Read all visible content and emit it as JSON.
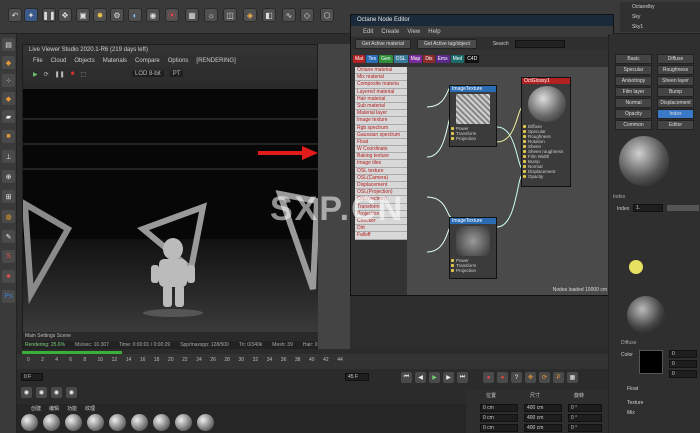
{
  "top_menu": {
    "right_items": [
      "Octanelby",
      "Sky",
      "Sky1"
    ]
  },
  "live_viewer": {
    "title": "Live Viewer Studio 2020.1-R6 (219 days left)",
    "menu": [
      "File",
      "Cloud",
      "Objects",
      "Materials",
      "Compare",
      "Options",
      "[RENDERING]"
    ],
    "toolbar": {
      "lod": "LOD 8-bit",
      "pt": "PT"
    },
    "status_tabs": [
      "Main",
      "Settings",
      "Scene"
    ],
    "stats": {
      "rendering": "Rendering: 25.6%",
      "ms": "Ms/sec: 10.307",
      "time": "Time: 0:00:01 / 0:00:29",
      "spp": "Spp/maxspp: 128/500",
      "tri": "Tri: 0/340k",
      "mesh": "Mesh: 39",
      "hair": "Hair: 0"
    }
  },
  "node_editor": {
    "title": "Octane Node Editor",
    "menu": [
      "Edit",
      "Create",
      "View",
      "Help"
    ],
    "buttons": {
      "get_material": "Get Active material",
      "get_tag": "Get Active tag/object",
      "search": "Search"
    },
    "tags": [
      {
        "label": "Mat",
        "color": "#b22222"
      },
      {
        "label": "Tex",
        "color": "#2a6db5"
      },
      {
        "label": "Gen",
        "color": "#2f8f3a"
      },
      {
        "label": "OSL",
        "color": "#3a7a9a"
      },
      {
        "label": "Map",
        "color": "#7a2a9a"
      },
      {
        "label": "Dis",
        "color": "#8a2a2a"
      },
      {
        "label": "Ems",
        "color": "#5a2a8a"
      },
      {
        "label": "Med",
        "color": "#1a6a6a"
      },
      {
        "label": "C4D",
        "color": "#111111"
      }
    ],
    "node_list": [
      "Octane material",
      "Mix material",
      "Composite materia",
      "Layered material",
      "Hair material",
      "Sub material",
      "Material layer",
      "Image texture",
      "Rgb spectrum",
      "Gaussian spectrum",
      "Float",
      "W Coordinate",
      "Baking texture",
      "Image tiles",
      "OSL texture",
      "OSL(Camera)",
      "Displacement",
      "OSL(Projection)",
      "OSL(vectron)",
      "Transform",
      "Projection",
      "Checker",
      "Dirt",
      "Falloff"
    ],
    "nodes": {
      "image_texture": {
        "title": "ImageTexture",
        "ports": [
          "Power",
          "Transform",
          "Projection"
        ]
      },
      "image_texture2": {
        "title": "ImageTexture",
        "ports": [
          "Power",
          "Transform",
          "Projection"
        ]
      },
      "material": {
        "title": "OctGlossy1",
        "ports": [
          "Diffuse",
          "Specular",
          "Roughness",
          "Rotation",
          "Sheen",
          "Sheen roughness",
          "Film Width",
          "Bump",
          "Normal",
          "Displacement",
          "Opacity"
        ]
      }
    },
    "footer": "Nodes loaded    10000 cm"
  },
  "attributes": {
    "top_tags": [
      "Octanelby",
      "Sky",
      "Sky1"
    ],
    "channels": [
      "Basic",
      "Diffuse",
      "Specular",
      "Roughness",
      "Anisotropy",
      "Sheen layer",
      "Film layer",
      "Bump",
      "Normal",
      "Displacement",
      "Opacity",
      "Index",
      "Common",
      "Editor"
    ],
    "header": "Index",
    "index_label": "Index",
    "index_value": "1.",
    "diffuse_header": "Diffuse",
    "color_label": "Color",
    "rgb": {
      "r": "0",
      "g": "0",
      "b": "0"
    },
    "float_label": "Float",
    "texture_label": "Texture",
    "mix_label": "Mix"
  },
  "timeline": {
    "ticks": [
      "0",
      "2",
      "4",
      "6",
      "8",
      "10",
      "12",
      "14",
      "16",
      "18",
      "20",
      "22",
      "24",
      "26",
      "28",
      "30",
      "32",
      "34",
      "36",
      "38",
      "40",
      "42",
      "44"
    ],
    "current_frame": "0 F",
    "end_frame": "45 F",
    "start_field": "0 F"
  },
  "materials_bar": {
    "tabs": [
      "创建",
      "编辑",
      "功能",
      "纹理"
    ]
  },
  "coords": {
    "labels": [
      "位置",
      "尺寸",
      "旋转"
    ],
    "values": [
      "0 cm",
      "400 cm",
      "0 °",
      "0 cm",
      "400 cm",
      "0 °",
      "0 cm",
      "400 cm",
      "0 °"
    ]
  },
  "watermark": "SXP.CN"
}
